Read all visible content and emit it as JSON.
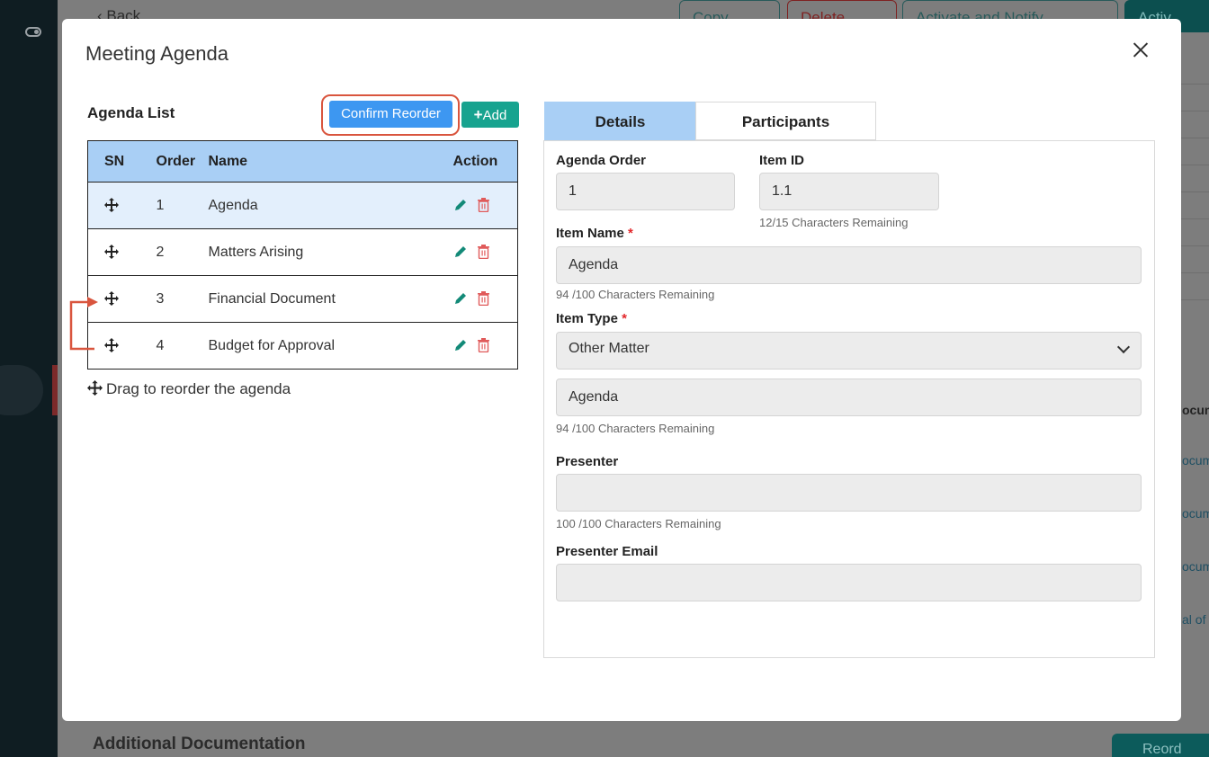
{
  "background": {
    "back_label": "‹ Back",
    "copy_label": "Copy",
    "delete_label": "Delete",
    "activate_notify_label": "Activate and Notify",
    "activate_label": "Activ",
    "docs_heading": "ocum",
    "docs_items": [
      "ocum",
      "ocum",
      "ocum",
      "al of"
    ],
    "footer_title": "Additional Documentation",
    "reorder_label": "Reord"
  },
  "modal": {
    "title": "Meeting Agenda"
  },
  "agenda": {
    "title": "Agenda List",
    "confirm_label": "Confirm Reorder",
    "add_label": "Add",
    "columns": {
      "sn": "SN",
      "order": "Order",
      "name": "Name",
      "action": "Action"
    },
    "rows": [
      {
        "order": "1",
        "name": "Agenda"
      },
      {
        "order": "2",
        "name": "Matters Arising"
      },
      {
        "order": "3",
        "name": "Financial Document"
      },
      {
        "order": "4",
        "name": "Budget for Approval"
      }
    ],
    "drag_hint": "Drag to reorder the agenda"
  },
  "tabs": {
    "details": "Details",
    "participants": "Participants"
  },
  "form": {
    "agenda_order_label": "Agenda Order",
    "agenda_order_value": "1",
    "item_id_label": "Item ID",
    "item_id_value": "1.1",
    "item_id_hint": "12/15 Characters Remaining",
    "item_name_label": "Item Name",
    "required_mark": "*",
    "item_name_value": "Agenda",
    "item_name_hint": "94 /100 Characters Remaining",
    "item_type_label": "Item Type",
    "item_type_value": "Other Matter",
    "item_type_detail_value": "Agenda",
    "item_type_detail_hint": "94 /100 Characters Remaining",
    "presenter_label": "Presenter",
    "presenter_value": "",
    "presenter_hint": "100 /100 Characters Remaining",
    "presenter_email_label": "Presenter Email",
    "presenter_email_value": ""
  },
  "colors": {
    "header_blue": "#a9cff5",
    "confirm_blue": "#3d97f1",
    "add_teal": "#17a38f",
    "annotation_red": "#d9553e",
    "required_red": "#e2262a"
  }
}
